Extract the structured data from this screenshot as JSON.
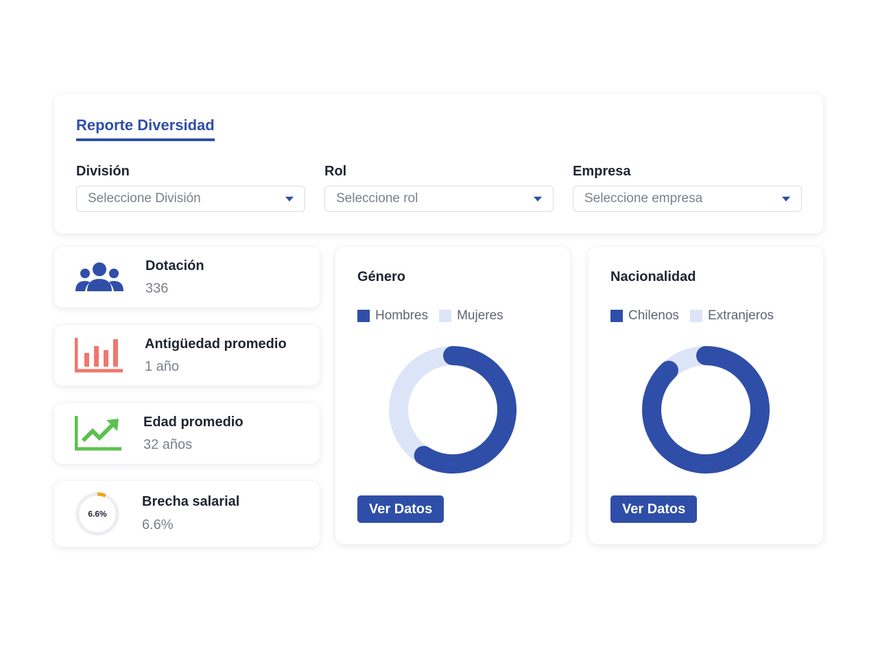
{
  "report": {
    "title": "Reporte Diversidad"
  },
  "filters": [
    {
      "label": "División",
      "placeholder": "Seleccione División"
    },
    {
      "label": "Rol",
      "placeholder": "Seleccione rol"
    },
    {
      "label": "Empresa",
      "placeholder": "Seleccione empresa"
    }
  ],
  "stats": [
    {
      "label": "Dotación",
      "value": "336",
      "icon": "users-icon"
    },
    {
      "label": "Antigüedad promedio",
      "value": "1 año",
      "icon": "bar-chart-icon"
    },
    {
      "label": "Edad promedio",
      "value": "32 años",
      "icon": "trending-up-icon"
    },
    {
      "label": "Brecha salarial",
      "value": "6.6%",
      "icon": "progress-ring-icon",
      "ring_text": "6.6%",
      "ring_fraction": 0.066
    }
  ],
  "charts": [
    {
      "title": "Género",
      "legend": [
        "Hombres",
        "Mujeres"
      ],
      "button": "Ver Datos"
    },
    {
      "title": "Nacionalidad",
      "legend": [
        "Chilenos",
        "Extranjeros"
      ],
      "button": "Ver Datos"
    }
  ],
  "chart_data": [
    {
      "type": "pie",
      "title": "Género",
      "categories": [
        "Hombres",
        "Mujeres"
      ],
      "values": [
        0.59,
        0.41
      ]
    },
    {
      "type": "pie",
      "title": "Nacionalidad",
      "categories": [
        "Chilenos",
        "Extranjeros"
      ],
      "values": [
        0.88,
        0.12
      ]
    }
  ],
  "colors": {
    "primary": "#2f4ea8",
    "light": "#dce4f8",
    "orange": "#f6a21a",
    "red": "#f0766d",
    "green": "#5cc14f",
    "ring_track": "#eceef2"
  }
}
